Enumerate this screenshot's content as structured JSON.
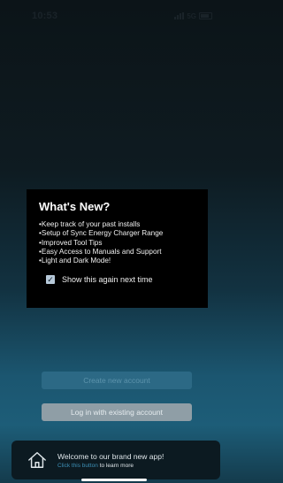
{
  "status_bar": {
    "time": "10:53",
    "network": "5G"
  },
  "modal": {
    "title": "What's New?",
    "features": [
      "Keep track of your past installs",
      "Setup of Sync Energy Charger Range",
      "Improved Tool Tips",
      "Easy Access to Manuals and Support",
      "Light and Dark Mode!"
    ],
    "checkbox_checked": true,
    "checkbox_label": "Show this again next time"
  },
  "buttons": {
    "create_account": "Create new account",
    "login": "Log in with existing account"
  },
  "banner": {
    "icon": "home-icon",
    "title": "Welcome to our brand new app!",
    "link_text": "Click this button",
    "rest_text": " to learn more"
  },
  "colors": {
    "create_button": "#2c6985",
    "login_button": "#8f9ea6",
    "link": "#3d8fb6"
  }
}
